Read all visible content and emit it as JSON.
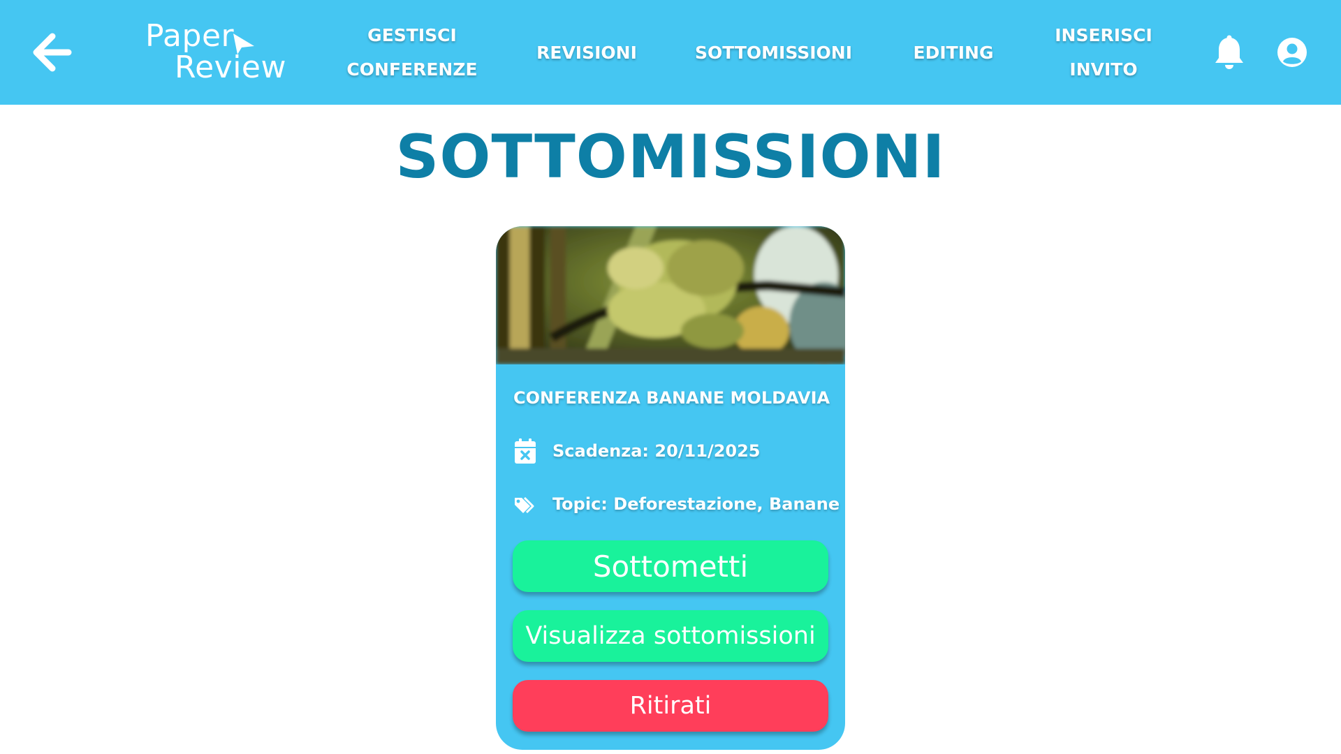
{
  "header": {
    "logo_line1": "Paper",
    "logo_line2": "Review",
    "nav": {
      "gestisci": "GESTISCI\nCONFERENZE",
      "revisioni": "REVISIONI",
      "sottomissioni": "SOTTOMISSIONI",
      "editing": "EDITING",
      "inserisci": "INSERISCI\nINVITO"
    },
    "icons": {
      "back": "arrow-left-icon",
      "notifications": "bell-icon",
      "profile": "user-circle-icon"
    }
  },
  "page": {
    "title": "SOTTOMISSIONI"
  },
  "card": {
    "image": "banana-tree-photo",
    "title": "CONFERENZA BANANE MOLDAVIA",
    "deadline_label": "Scadenza:",
    "deadline_value": "20/11/2025",
    "topic_label": "Topic:",
    "topic_value": "Deforestazione, Banane",
    "buttons": {
      "submit": "Sottometti",
      "view": "Visualizza sottomissioni",
      "withdraw": "Ritirati"
    }
  },
  "colors": {
    "header_bg": "#45C6F2",
    "title_color": "#0E7FA6",
    "card_bg": "#45C6F2",
    "green_button": "#19F29B",
    "red_button": "#FF3E5A"
  }
}
